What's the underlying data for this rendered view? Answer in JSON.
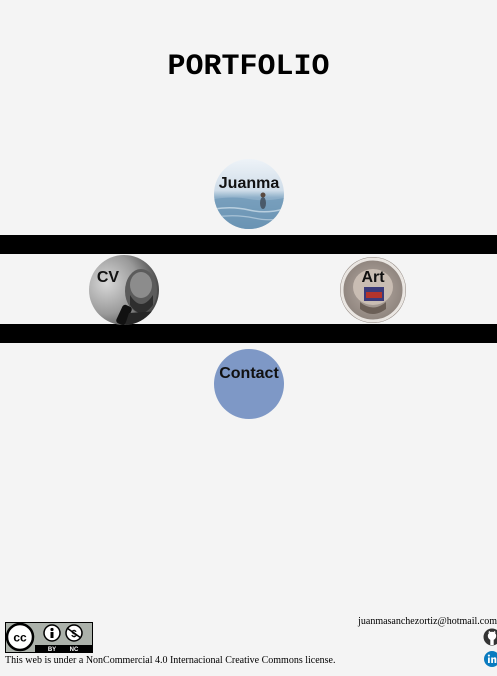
{
  "header": {
    "title": "PORTFOLIO"
  },
  "nav": {
    "juanma": "Juanma",
    "cv": "CV",
    "art": "Art",
    "contact": "Contact"
  },
  "footer": {
    "license_text": "This web is under a NonCommercial 4.0 Internacional Creative Commons license.",
    "badge_text": {
      "cc": "cc",
      "by": "BY",
      "nc": "NC"
    },
    "email": "juanmasanchezortiz@hotmail.com",
    "icons": [
      "github-icon",
      "linkedin-icon"
    ]
  },
  "colors": {
    "background": "#f4f4f4",
    "bands": "#000000",
    "contact_circle": "#7e98c6"
  }
}
